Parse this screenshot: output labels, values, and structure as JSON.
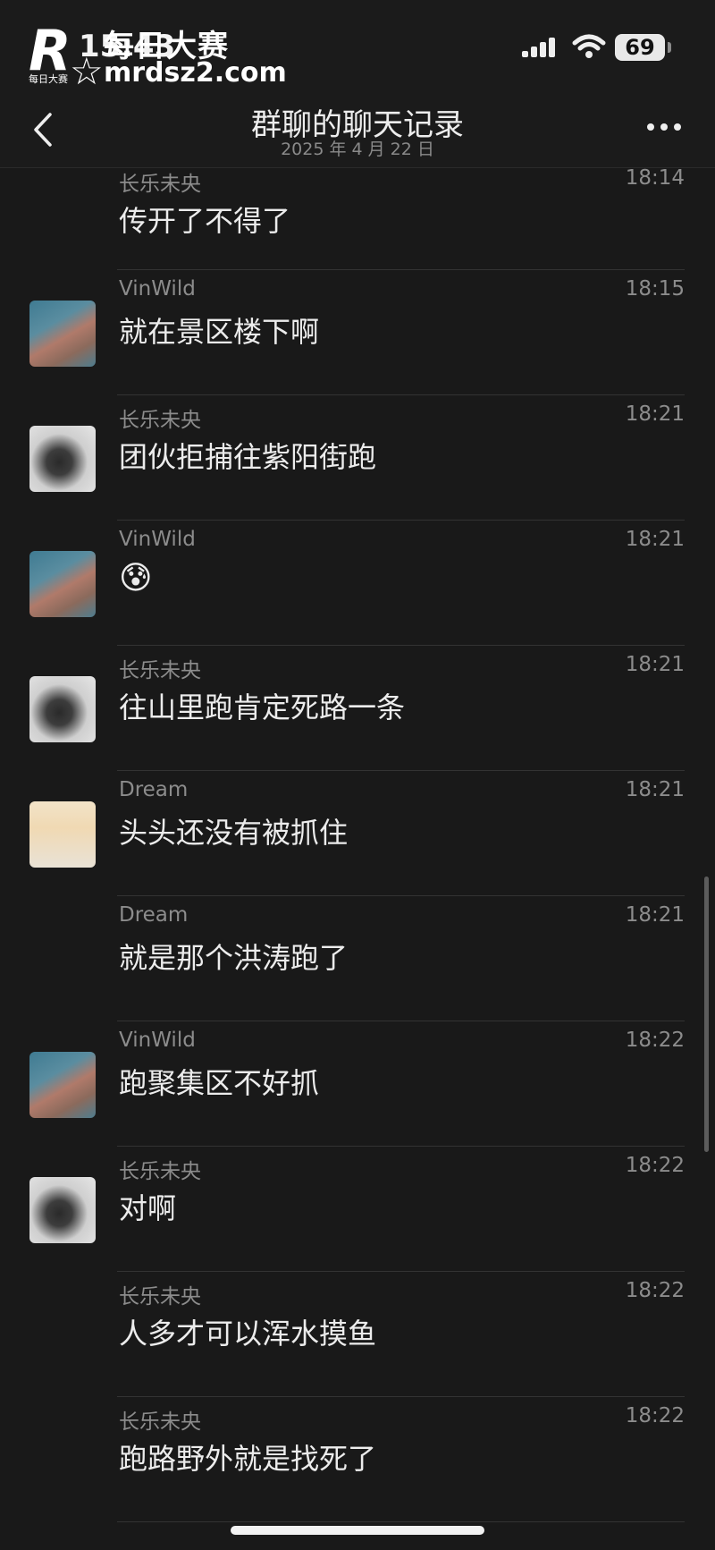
{
  "status_bar": {
    "time": "15:43",
    "battery": "69"
  },
  "watermark": {
    "cn": "每日大赛",
    "url": "mrdsz2.com",
    "small": "每日大赛"
  },
  "nav": {
    "title": "群聊的聊天记录",
    "date": "2025 年 4 月 22 日"
  },
  "messages": [
    {
      "name": "长乐未央",
      "time": "18:14",
      "text": "传开了不得了",
      "avatar": "none"
    },
    {
      "name": "VinWild",
      "time": "18:15",
      "text": "就在景区楼下啊",
      "avatar": "elephant"
    },
    {
      "name": "长乐未央",
      "time": "18:21",
      "text": "团伙拒捕往紫阳街跑",
      "avatar": "ink"
    },
    {
      "name": "VinWild",
      "time": "18:21",
      "text": "😰",
      "avatar": "elephant"
    },
    {
      "name": "长乐未央",
      "time": "18:21",
      "text": "往山里跑肯定死路一条",
      "avatar": "ink"
    },
    {
      "name": "Dream",
      "time": "18:21",
      "text": "头头还没有被抓住",
      "avatar": "girl"
    },
    {
      "name": "Dream",
      "time": "18:21",
      "text": "就是那个洪涛跑了",
      "avatar": "none"
    },
    {
      "name": "VinWild",
      "time": "18:22",
      "text": "跑聚集区不好抓",
      "avatar": "elephant"
    },
    {
      "name": "长乐未央",
      "time": "18:22",
      "text": "对啊",
      "avatar": "ink"
    },
    {
      "name": "长乐未央",
      "time": "18:22",
      "text": "人多才可以浑水摸鱼",
      "avatar": "none"
    },
    {
      "name": "长乐未央",
      "time": "18:22",
      "text": "跑路野外就是找死了",
      "avatar": "none"
    }
  ]
}
